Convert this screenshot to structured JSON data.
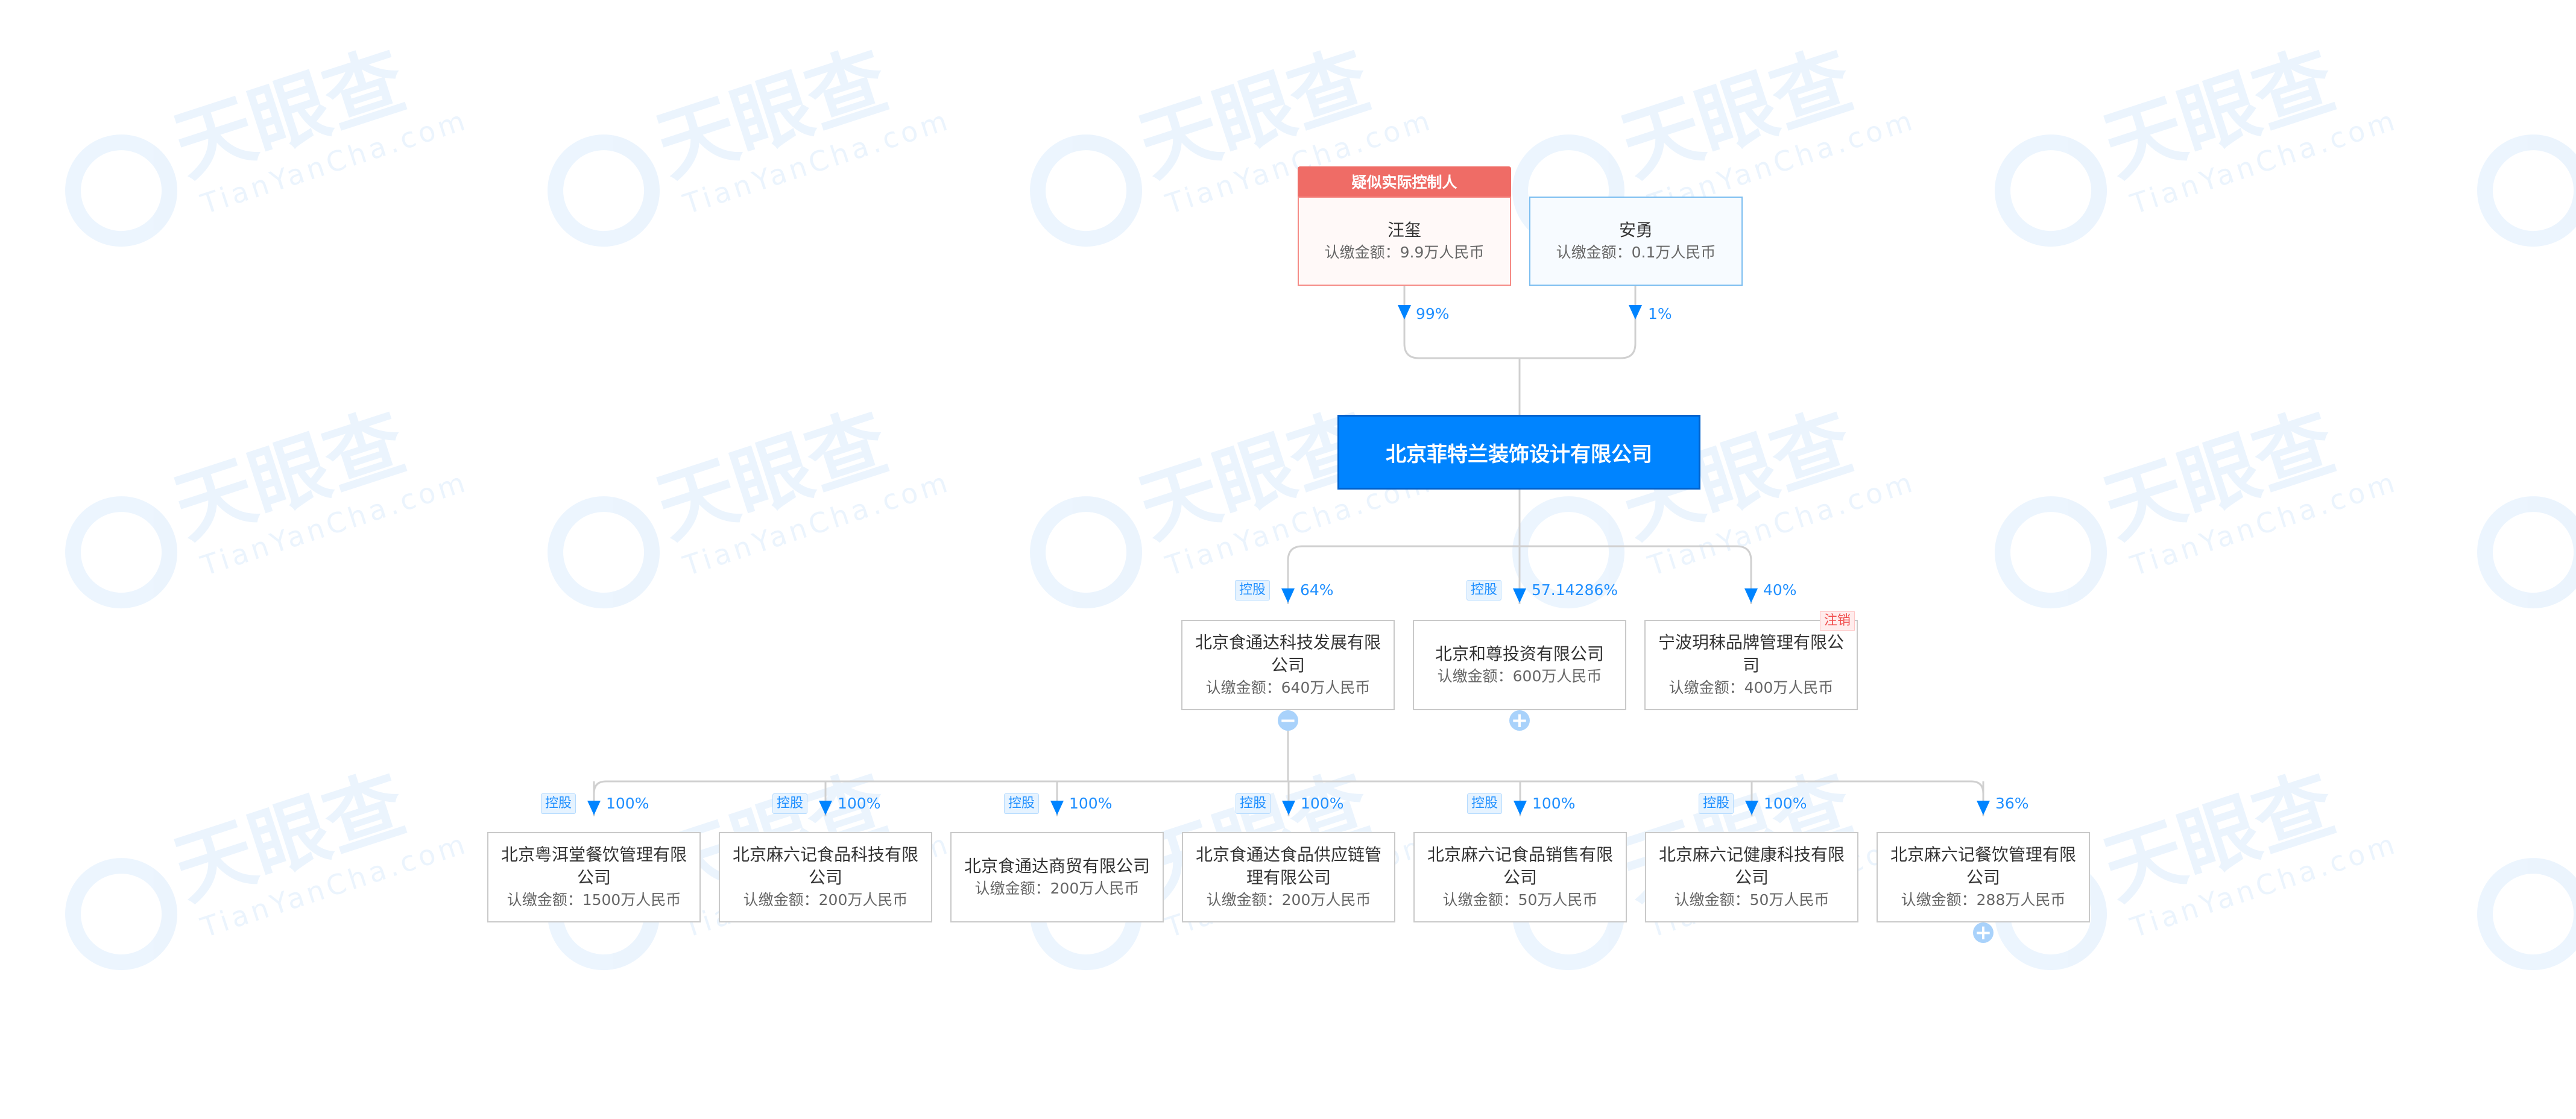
{
  "watermark": {
    "brand": "天眼查",
    "url": "TianYanCha.com"
  },
  "controller_label": "疑似实际控制人",
  "shareholders": [
    {
      "name": "汪玺",
      "amount": "认缴金额：9.9万人民币",
      "percent": "99%"
    },
    {
      "name": "安勇",
      "amount": "认缴金额：0.1万人民币",
      "percent": "1%"
    }
  ],
  "company": "北京菲特兰装饰设计有限公司",
  "investments": [
    {
      "name": "北京食通达科技发展有限公司",
      "amount": "认缴金额：640万人民币",
      "percent": "64%",
      "tag": "控股",
      "toggle": "−"
    },
    {
      "name": "北京和尊投资有限公司",
      "amount": "认缴金额：600万人民币",
      "percent": "57.14286%",
      "tag": "控股",
      "toggle": "+"
    },
    {
      "name": "宁波玥秣品牌管理有限公司",
      "amount": "认缴金额：400万人民币",
      "percent": "40%",
      "status": "注销"
    }
  ],
  "sub_investments": [
    {
      "name": "北京粤洱堂餐饮管理有限公司",
      "amount": "认缴金额：1500万人民币",
      "percent": "100%",
      "tag": "控股"
    },
    {
      "name": "北京麻六记食品科技有限公司",
      "amount": "认缴金额：200万人民币",
      "percent": "100%",
      "tag": "控股"
    },
    {
      "name": "北京食通达商贸有限公司",
      "amount": "认缴金额：200万人民币",
      "percent": "100%",
      "tag": "控股"
    },
    {
      "name": "北京食通达食品供应链管理有限公司",
      "amount": "认缴金额：200万人民币",
      "percent": "100%",
      "tag": "控股"
    },
    {
      "name": "北京麻六记食品销售有限公司",
      "amount": "认缴金额：50万人民币",
      "percent": "100%",
      "tag": "控股"
    },
    {
      "name": "北京麻六记健康科技有限公司",
      "amount": "认缴金额：50万人民币",
      "percent": "100%",
      "tag": "控股"
    },
    {
      "name": "北京麻六记餐饮管理有限公司",
      "amount": "认缴金额：288万人民币",
      "percent": "36%",
      "toggle": "+"
    }
  ],
  "colors": {
    "accent": "#0084ff",
    "controller": "#ef6c66",
    "line": "#d0d0d0",
    "tag": "#1f8fff"
  }
}
